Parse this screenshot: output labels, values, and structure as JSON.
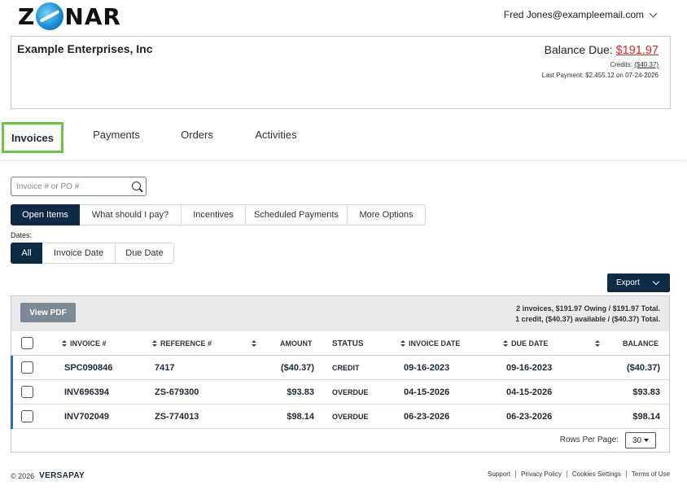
{
  "brand": {
    "logo_text_left": "Z",
    "logo_text_right": "NAR",
    "accent_green": "#6cc24a",
    "navy": "#0f2a44",
    "red": "#c8302a"
  },
  "user": {
    "email": "Fred Jones@exampleemail.com"
  },
  "account": {
    "name": "Example Enterprises, Inc",
    "balance_label": "Balance Due:",
    "balance_amount": "$191.97",
    "credits_label": "Credits:",
    "credits_amount": "($40.37)",
    "last_payment": "Last Payment: $2,455.12 on 07-24-2026"
  },
  "tabs": [
    {
      "label": "Invoices",
      "active": true
    },
    {
      "label": "Payments",
      "active": false
    },
    {
      "label": "Orders",
      "active": false
    },
    {
      "label": "Activities",
      "active": false
    }
  ],
  "search": {
    "placeholder": "Invoice # or PO #"
  },
  "filters": [
    "Open Items",
    "What should I pay?",
    "Incentives",
    "Scheduled Payments",
    "More Options"
  ],
  "dates": {
    "label": "Dates:",
    "options": [
      "All",
      "Invoice Date",
      "Due Date"
    ]
  },
  "export_label": "Export",
  "table": {
    "view_pdf": "View PDF",
    "summary_line1": "2 invoices, $191.97 Owing / $191.97 Total.",
    "summary_line2": "1 credit, ($40.37) available / ($40.37) Total.",
    "headers": {
      "invoice": "INVOICE #",
      "reference": "REFERENCE #",
      "amount": "AMOUNT",
      "status": "STATUS",
      "invoice_date": "INVOICE DATE",
      "due_date": "DUE DATE",
      "balance": "BALANCE"
    },
    "rows": [
      {
        "invoice": "SPC090846",
        "reference": "7417",
        "amount": "($40.37)",
        "status": "CREDIT",
        "invoice_date": "09-16-2023",
        "due_date": "09-16-2023",
        "balance": "($40.37)"
      },
      {
        "invoice": "INV696394",
        "reference": "ZS-679300",
        "amount": "$93.83",
        "status": "OVERDUE",
        "invoice_date": "04-15-2026",
        "due_date": "04-15-2026",
        "balance": "$93.83"
      },
      {
        "invoice": "INV702049",
        "reference": "ZS-774013",
        "amount": "$98.14",
        "status": "OVERDUE",
        "invoice_date": "06-23-2026",
        "due_date": "06-23-2026",
        "balance": "$98.14"
      }
    ],
    "rows_per_page_label": "Rows Per Page:",
    "rows_per_page": "30"
  },
  "footer": {
    "copyright": "© 2026",
    "brand": "VERSAPAY",
    "links": [
      "Support",
      "Privacy Policy",
      "Cookies Settings",
      "Terms of Use"
    ]
  }
}
